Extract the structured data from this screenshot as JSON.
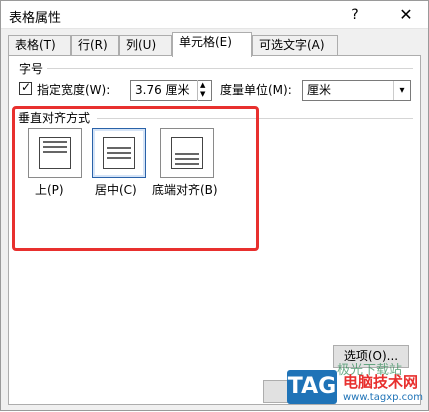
{
  "window": {
    "title": "表格属性",
    "help_label": "?",
    "close_label": "✕"
  },
  "tabs": [
    {
      "label": "表格(T)"
    },
    {
      "label": "行(R)"
    },
    {
      "label": "列(U)"
    },
    {
      "label": "单元格(E)"
    },
    {
      "label": "可选文字(A)"
    }
  ],
  "size_section": {
    "title": "字号",
    "specify_width_label": "指定宽度(W):",
    "specify_width_checked": true,
    "width_value": "3.76 厘米",
    "measure_label": "度量单位(M):",
    "measure_value": "厘米"
  },
  "vertical_align": {
    "title": "垂直对齐方式",
    "options": [
      {
        "label": "上(P)"
      },
      {
        "label": "居中(C)",
        "selected": true
      },
      {
        "label": "底端对齐(B)"
      }
    ]
  },
  "buttons": {
    "options_label": "选项(O)..."
  },
  "watermark": {
    "tag": "TAG",
    "site_name": "电脑技术网",
    "url": "www.tagxp.com",
    "top_text": "极光下载站"
  },
  "colors": {
    "highlight": "#e8302e",
    "selected_border": "#2a62a8",
    "tag_blue": "#1f73b7"
  }
}
